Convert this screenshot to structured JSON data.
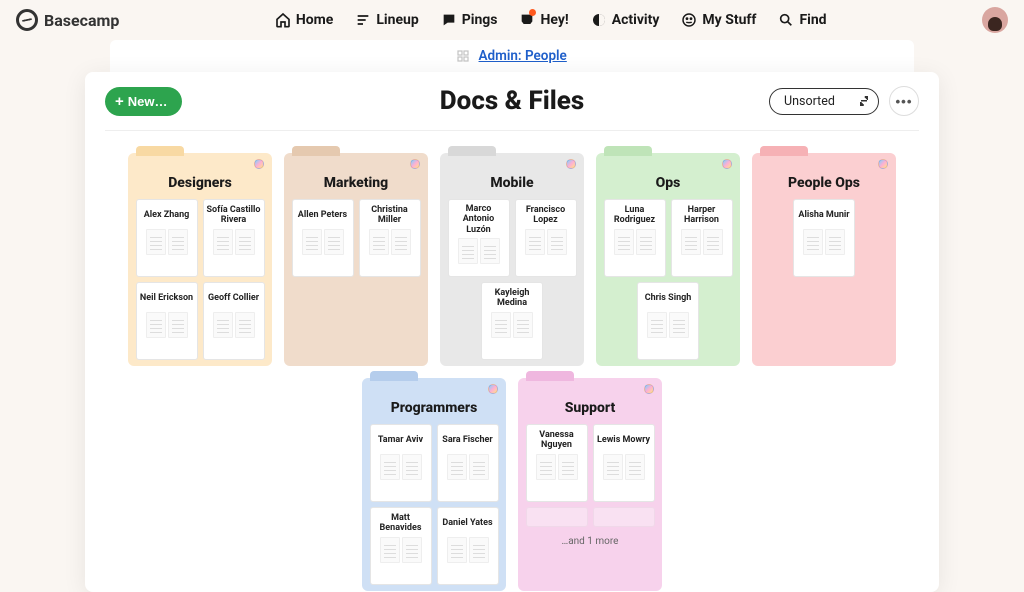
{
  "brand": "Basecamp",
  "nav": {
    "home": "Home",
    "lineup": "Lineup",
    "pings": "Pings",
    "hey": "Hey!",
    "activity": "Activity",
    "mystuff": "My Stuff",
    "find": "Find"
  },
  "breadcrumb": {
    "label": "Admin: People"
  },
  "newButton": "New…",
  "pageTitle": "Docs & Files",
  "sortLabel": "Unsorted",
  "moreLabel": "•••",
  "folders": [
    {
      "key": "designers",
      "title": "Designers",
      "cls": "f-designers",
      "cards": [
        "Alex Zhang",
        "Sofía Castillo Rivera",
        "Neil Erickson",
        "Geoff Collier"
      ]
    },
    {
      "key": "marketing",
      "title": "Marketing",
      "cls": "f-marketing",
      "cards": [
        "Allen Peters",
        "Christina Miller"
      ]
    },
    {
      "key": "mobile",
      "title": "Mobile",
      "cls": "f-mobile",
      "cards": [
        "Marco Antonio Luzón",
        "Francisco Lopez",
        "Kayleigh Medina"
      ]
    },
    {
      "key": "ops",
      "title": "Ops",
      "cls": "f-ops",
      "cards": [
        "Luna Rodriguez",
        "Harper Harrison",
        "Chris Singh"
      ]
    },
    {
      "key": "peopleops",
      "title": "People Ops",
      "cls": "f-peopleops",
      "cards": [
        "Alisha Munir"
      ]
    },
    {
      "key": "programmers",
      "title": "Programmers",
      "cls": "f-programmers",
      "cards": [
        "Tamar Aviv",
        "Sara Fischer",
        "Matt Benavides",
        "Daniel Yates"
      ]
    },
    {
      "key": "support",
      "title": "Support",
      "cls": "f-support",
      "cards": [
        "Vanessa Nguyen",
        "Lewis Mowry"
      ],
      "more": "…and 1 more"
    }
  ]
}
